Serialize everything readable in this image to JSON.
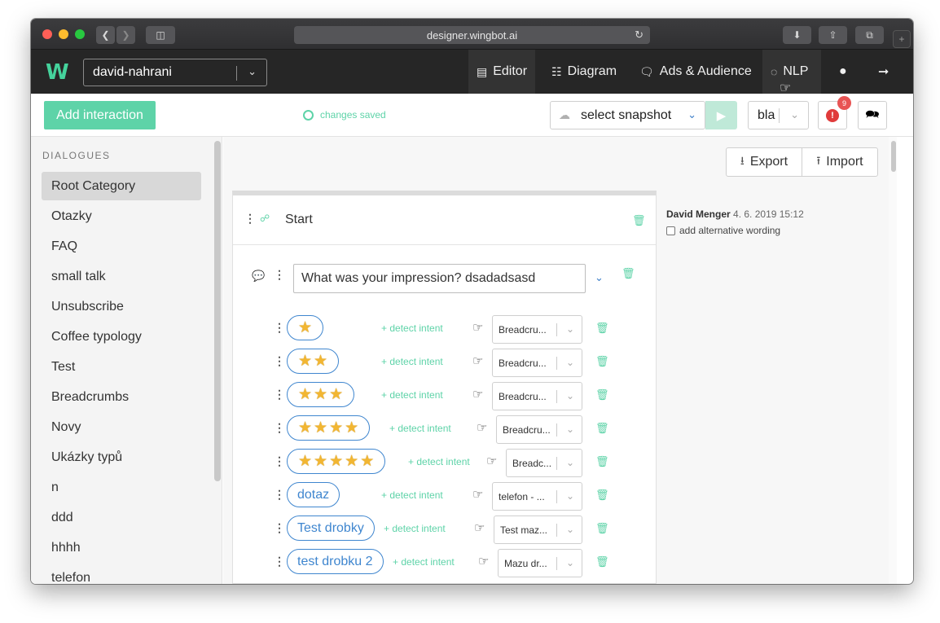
{
  "browser": {
    "url": "designer.wingbot.ai"
  },
  "nav": {
    "logo": "W",
    "project": "david-nahrani",
    "items": [
      {
        "label": "Editor",
        "icon": "list-icon"
      },
      {
        "label": "Diagram",
        "icon": "sitemap-icon"
      },
      {
        "label": "Ads & Audience",
        "icon": "comment-icon"
      },
      {
        "label": "NLP",
        "icon": "lightbulb-icon"
      }
    ]
  },
  "toolbar": {
    "add_label": "Add interaction",
    "saved_label": "changes saved",
    "snapshot_label": "select snapshot",
    "bla_value": "bla",
    "error_badge": "9"
  },
  "sidebar": {
    "title": "DIALOGUES",
    "items": [
      "Root Category",
      "Otazky",
      "FAQ",
      "small talk",
      "Unsubscribe",
      "Coffee typology",
      "Test",
      "Breadcrumbs",
      "Novy",
      "Ukázky typů",
      "n",
      "ddd",
      "hhhh",
      "telefon"
    ]
  },
  "main": {
    "export_label": "Export",
    "import_label": "Import",
    "card_title": "Start",
    "message": "What was your impression? dsadadsasd",
    "author": "David Menger",
    "date": "4. 6. 2019 15:12",
    "alt_wording": "add alternative wording",
    "detect_label": "+ detect intent",
    "replies": [
      {
        "stars": 1,
        "target": "Breadcru..."
      },
      {
        "stars": 2,
        "target": "Breadcru..."
      },
      {
        "stars": 3,
        "target": "Breadcru..."
      },
      {
        "stars": 4,
        "target": "Breadcru..."
      },
      {
        "stars": 5,
        "target": "Breadc..."
      },
      {
        "label": "dotaz",
        "target": "telefon - ..."
      },
      {
        "label": "Test drobky",
        "target": "Test maz..."
      },
      {
        "label": "test drobku 2",
        "target": "Mazu dr..."
      }
    ]
  }
}
